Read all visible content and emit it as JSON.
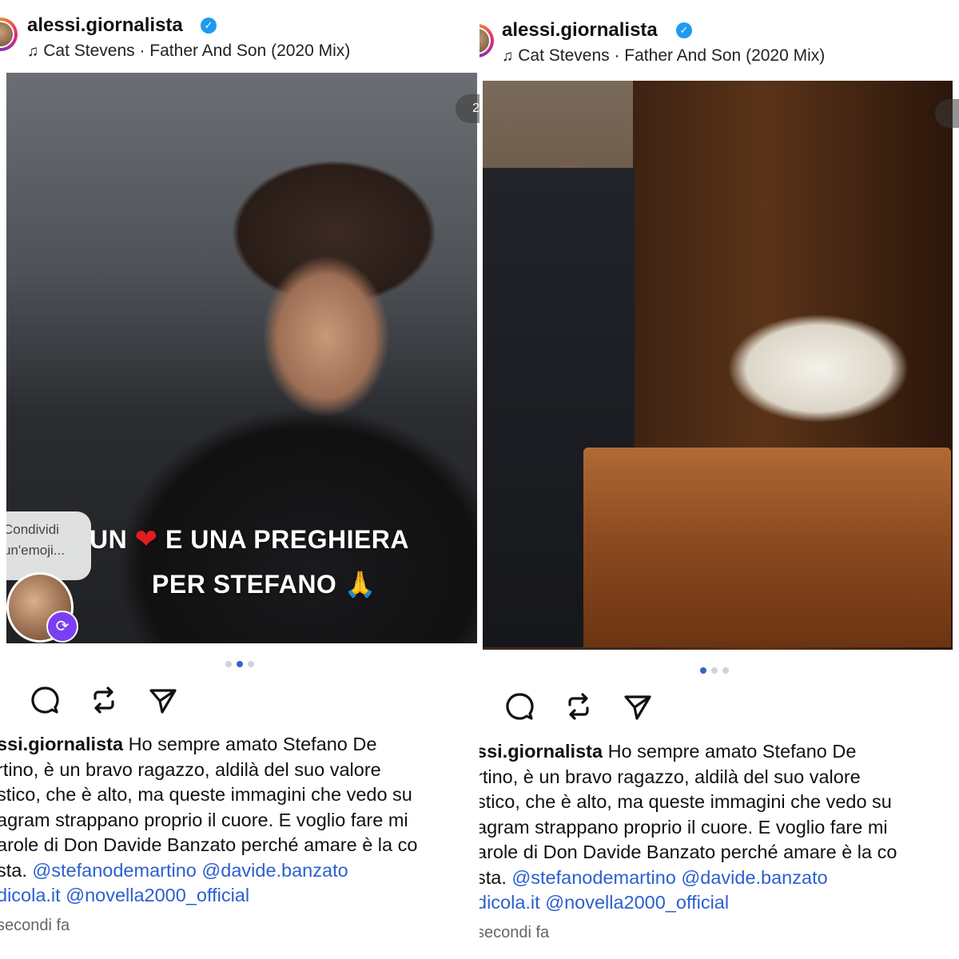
{
  "posts": [
    {
      "header": {
        "username": "alessi.giornalista",
        "music": "Cat Stevens · Father And Son (2020 Mix)"
      },
      "photo": {
        "overlay_line1_a": "UN",
        "overlay_line1_b": "E UNA PREGHIERA",
        "overlay_line2": "PER STEFANO",
        "share_bubble_1": "Condividi",
        "share_bubble_2": "un'emoji...",
        "next_indicator": "2"
      },
      "carousel": {
        "count": 3,
        "active": 2
      },
      "caption": {
        "username": "ssi.giornalista",
        "line1": "Ho sempre amato Stefano De",
        "line2": "rtino, è un bravo ragazzo, aldilà del suo valore",
        "line3": "stico, che è alto, ma queste immagini che vedo su",
        "line4": "agram strappano proprio il cuore. E voglio fare mi",
        "line5": "arole di Don Davide Banzato perché amare è la co",
        "line6_a": "sta.",
        "mention1": "@stefanodemartino",
        "mention2": "@davide.banzato",
        "mention3": "dicola.it",
        "mention4": "@novella2000_official"
      },
      "timestamp": "secondi fa"
    },
    {
      "header": {
        "username": "alessi.giornalista",
        "music": "Cat Stevens · Father And Son (2020 Mix)"
      },
      "carousel": {
        "count": 3,
        "active": 1
      },
      "caption": {
        "username": "ssi.giornalista",
        "line1": "Ho sempre amato Stefano De",
        "line2": "rtino, è un bravo ragazzo, aldilà del suo valore",
        "line3": "stico, che è alto, ma queste immagini che vedo su",
        "line4": "agram strappano proprio il cuore. E voglio fare mi",
        "line5": "arole di Don Davide Banzato perché amare è la co",
        "line6_a": "sta.",
        "mention1": "@stefanodemartino",
        "mention2": "@davide.banzato",
        "mention3": "dicola.it",
        "mention4": "@novella2000_official"
      },
      "timestamp": "secondi fa"
    }
  ],
  "icons": [
    "comment-icon",
    "repost-icon",
    "send-icon",
    "music-note-icon",
    "verified-badge-icon",
    "heart-emoji-icon",
    "praying-hands-emoji-icon"
  ],
  "colors": {
    "mention": "#2c5fd0",
    "verified": "#1d9bf0",
    "dot_active": "#3366cc",
    "dot_inactive": "#cfd3da"
  }
}
